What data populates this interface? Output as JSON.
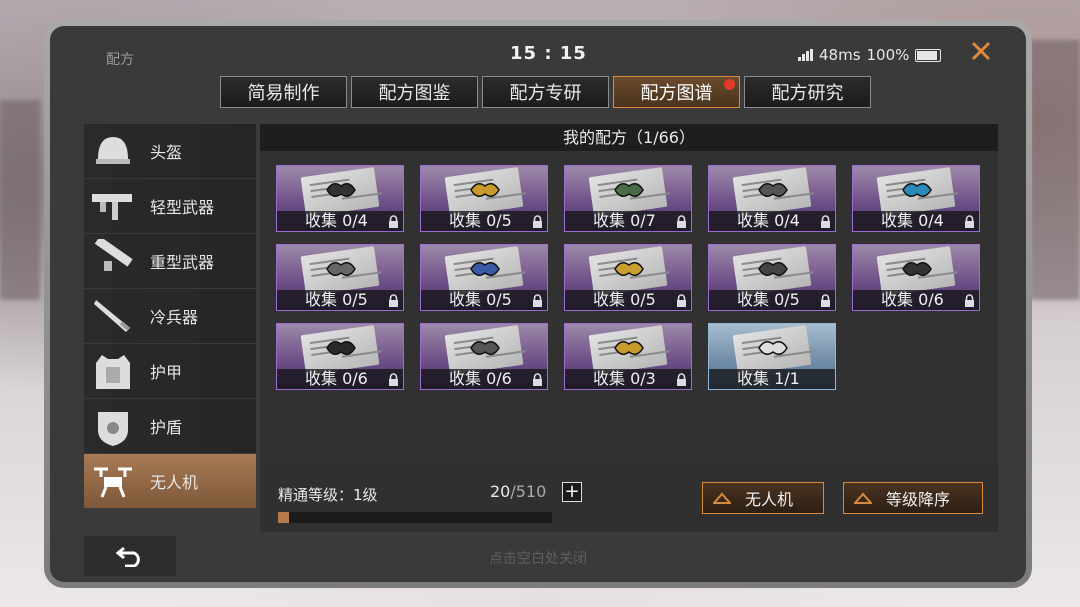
{
  "window": {
    "title": "配方",
    "time": "15 : 15",
    "ping": "48ms",
    "battery": "100%"
  },
  "tabs": [
    {
      "label": "简易制作",
      "active": false,
      "badge": false
    },
    {
      "label": "配方图鉴",
      "active": false,
      "badge": false
    },
    {
      "label": "配方专研",
      "active": false,
      "badge": false
    },
    {
      "label": "配方图谱",
      "active": true,
      "badge": true
    },
    {
      "label": "配方研究",
      "active": false,
      "badge": false
    }
  ],
  "sidebar": {
    "items": [
      {
        "label": "头盔",
        "icon": "helmet-icon"
      },
      {
        "label": "轻型武器",
        "icon": "smg-icon"
      },
      {
        "label": "重型武器",
        "icon": "launcher-icon"
      },
      {
        "label": "冷兵器",
        "icon": "blade-icon"
      },
      {
        "label": "护甲",
        "icon": "armor-vest-icon"
      },
      {
        "label": "护盾",
        "icon": "shield-icon"
      },
      {
        "label": "无人机",
        "icon": "drone-icon",
        "active": true
      }
    ]
  },
  "main": {
    "header": "我的配方（1/66）",
    "recipes": [
      {
        "label": "收集 0/4",
        "locked": true,
        "rarity": "purple"
      },
      {
        "label": "收集 0/5",
        "locked": true,
        "rarity": "purple"
      },
      {
        "label": "收集 0/7",
        "locked": true,
        "rarity": "purple"
      },
      {
        "label": "收集 0/4",
        "locked": true,
        "rarity": "purple"
      },
      {
        "label": "收集 0/4",
        "locked": true,
        "rarity": "purple"
      },
      {
        "label": "收集 0/5",
        "locked": true,
        "rarity": "purple"
      },
      {
        "label": "收集 0/5",
        "locked": true,
        "rarity": "purple"
      },
      {
        "label": "收集 0/5",
        "locked": true,
        "rarity": "purple"
      },
      {
        "label": "收集 0/5",
        "locked": true,
        "rarity": "purple"
      },
      {
        "label": "收集 0/6",
        "locked": true,
        "rarity": "purple"
      },
      {
        "label": "收集 0/6",
        "locked": true,
        "rarity": "purple"
      },
      {
        "label": "收集 0/6",
        "locked": true,
        "rarity": "purple"
      },
      {
        "label": "收集 0/3",
        "locked": true,
        "rarity": "purple"
      },
      {
        "label": "收集 1/1",
        "locked": false,
        "rarity": "blue"
      }
    ]
  },
  "footer": {
    "mastery_label": "精通等级：1级",
    "progress_current": "20",
    "progress_total": "/510",
    "progress_fraction": 0.039,
    "filter_button": "无人机",
    "sort_button": "等级降序"
  },
  "bottom": {
    "hint": "点击空白处关闭"
  },
  "colors": {
    "accent": "#d98a3a",
    "purple": "#a06bd0",
    "blue": "#8fb7d8",
    "badge": "#e23a2a"
  }
}
